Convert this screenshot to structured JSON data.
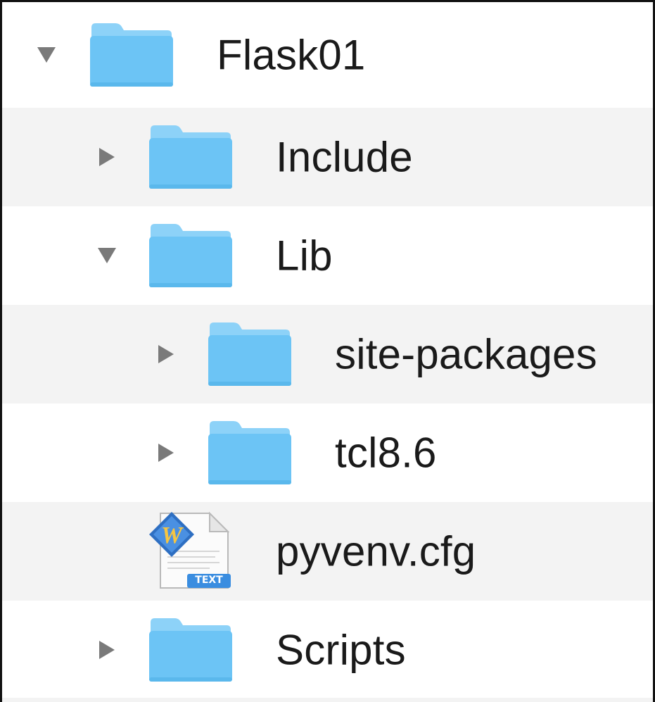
{
  "tree": {
    "items": [
      {
        "label": "Flask01",
        "type": "folder",
        "expanded": true,
        "level": 0
      },
      {
        "label": "Include",
        "type": "folder",
        "expanded": false,
        "level": 1
      },
      {
        "label": "Lib",
        "type": "folder",
        "expanded": true,
        "level": 1
      },
      {
        "label": "site-packages",
        "type": "folder",
        "expanded": false,
        "level": 2
      },
      {
        "label": "tcl8.6",
        "type": "folder",
        "expanded": false,
        "level": 2
      },
      {
        "label": "pyvenv.cfg",
        "type": "file",
        "icon": "text-file-icon",
        "badge": "TEXT",
        "level": 1
      },
      {
        "label": "Scripts",
        "type": "folder",
        "expanded": false,
        "level": 1
      }
    ]
  },
  "colors": {
    "folder": "#6cc4f5",
    "folder_tab": "#8dd2f8",
    "disclosure": "#7a7a7a",
    "alt_row": "#f3f3f3",
    "text": "#1a1a1a"
  }
}
